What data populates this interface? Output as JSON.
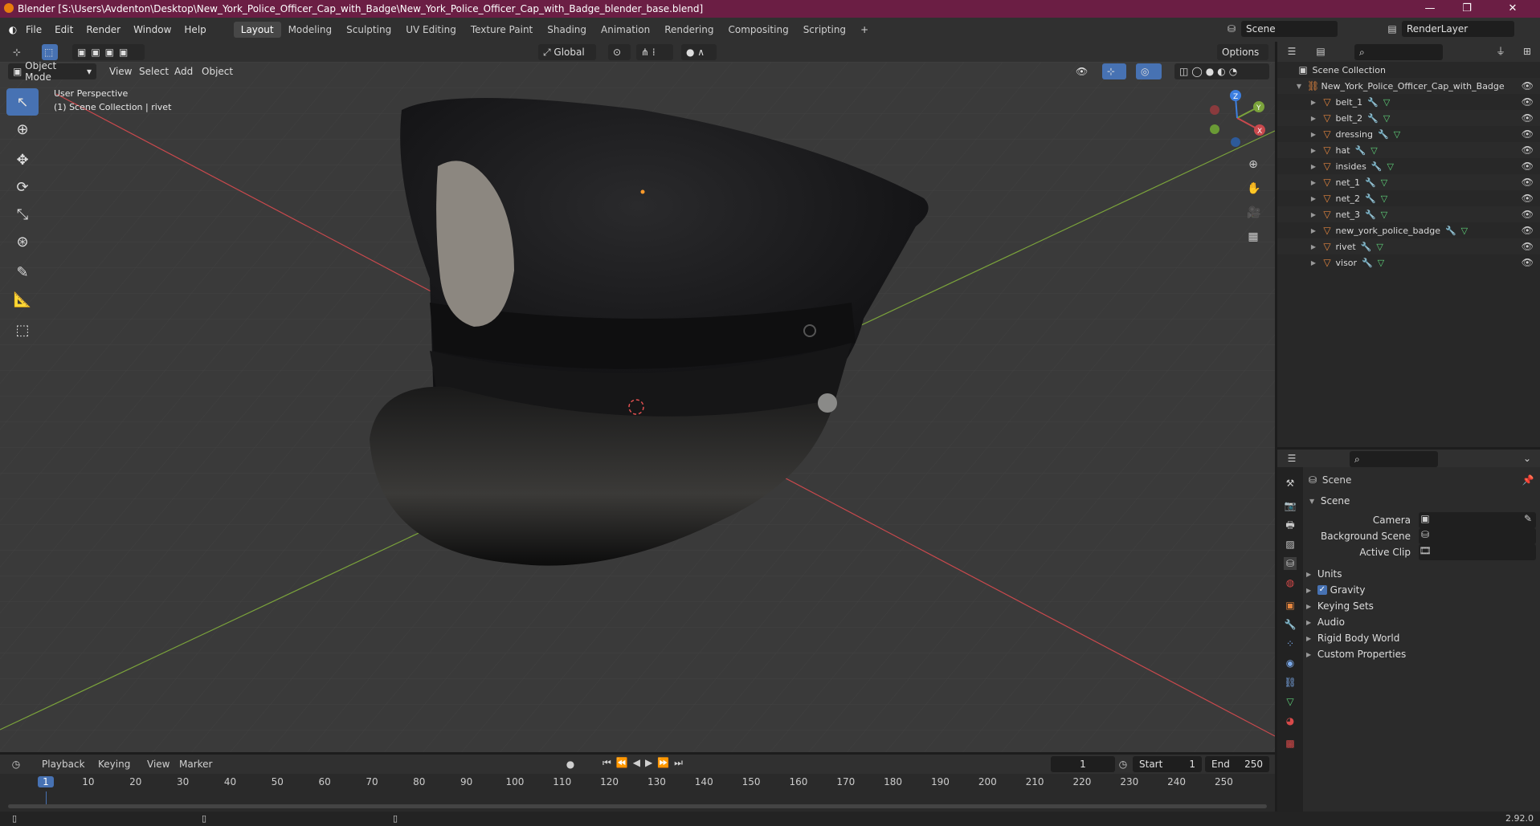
{
  "window": {
    "title": "Blender [S:\\Users\\Avdenton\\Desktop\\New_York_Police_Officer_Cap_with_Badge\\New_York_Police_Officer_Cap_with_Badge_blender_base.blend]",
    "minimize": "—",
    "maximize": "❐",
    "close": "✕"
  },
  "menu": {
    "items": [
      "File",
      "Edit",
      "Render",
      "Window",
      "Help"
    ],
    "workspaces": [
      "Layout",
      "Modeling",
      "Sculpting",
      "UV Editing",
      "Texture Paint",
      "Shading",
      "Animation",
      "Rendering",
      "Compositing",
      "Scripting"
    ],
    "active_workspace": "Layout",
    "add_workspace": "+",
    "scene_name": "Scene",
    "render_layer": "RenderLayer"
  },
  "viewport_header": {
    "transform_orientation": "Global",
    "options": "Options",
    "mode": "Object Mode",
    "menus": [
      "View",
      "Select",
      "Add",
      "Object"
    ]
  },
  "viewport": {
    "perspective": "User Perspective",
    "collection_info": "(1) Scene Collection | rivet",
    "gizmo": {
      "x": "X",
      "y": "Y",
      "z": "Z"
    },
    "colors": {
      "x_axis": "#c9494d",
      "y_axis": "#7ba33b",
      "z_axis": "#3d7fe0",
      "grid": "#474747",
      "bg": "#3a3a3a"
    }
  },
  "outliner": {
    "root": "Scene Collection",
    "collection": "New_York_Police_Officer_Cap_with_Badge",
    "objects": [
      "belt_1",
      "belt_2",
      "dressing",
      "hat",
      "insides",
      "net_1",
      "net_2",
      "net_3",
      "new_york_police_badge",
      "rivet",
      "visor"
    ]
  },
  "properties": {
    "header": "Scene",
    "section": "Scene",
    "fields": [
      {
        "label": "Camera",
        "value": ""
      },
      {
        "label": "Background Scene",
        "value": ""
      },
      {
        "label": "Active Clip",
        "value": ""
      }
    ],
    "panels": [
      "Units",
      "Gravity",
      "Keying Sets",
      "Audio",
      "Rigid Body World",
      "Custom Properties"
    ],
    "gravity_checked": true
  },
  "timeline": {
    "menus": [
      "Playback",
      "Keying",
      "View",
      "Marker"
    ],
    "current_frame": "1",
    "start_label": "Start",
    "start": "1",
    "end_label": "End",
    "end": "250",
    "ticks": [
      "1",
      "10",
      "20",
      "30",
      "40",
      "50",
      "60",
      "70",
      "80",
      "90",
      "100",
      "110",
      "120",
      "130",
      "140",
      "150",
      "160",
      "170",
      "180",
      "190",
      "200",
      "210",
      "220",
      "230",
      "240",
      "250"
    ]
  },
  "status": {
    "version": "2.92.0"
  }
}
